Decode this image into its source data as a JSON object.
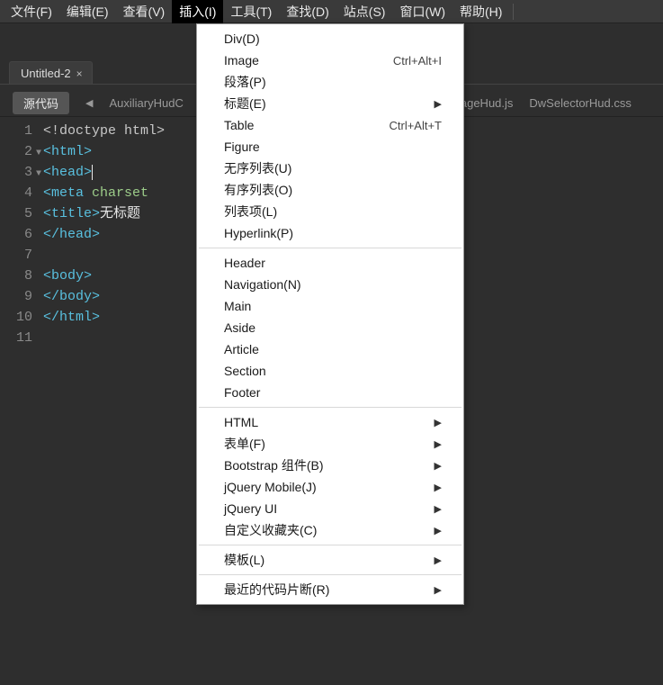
{
  "menubar": {
    "items": [
      {
        "label": "文件(F)"
      },
      {
        "label": "编辑(E)"
      },
      {
        "label": "查看(V)"
      },
      {
        "label": "插入(I)",
        "active": true
      },
      {
        "label": "工具(T)"
      },
      {
        "label": "查找(D)"
      },
      {
        "label": "站点(S)"
      },
      {
        "label": "窗口(W)"
      },
      {
        "label": "帮助(H)"
      }
    ]
  },
  "dropdown": {
    "groups": [
      [
        {
          "label": "Div(D)"
        },
        {
          "label": "Image",
          "shortcut": "Ctrl+Alt+I"
        },
        {
          "label": "段落(P)"
        },
        {
          "label": "标题(E)",
          "submenu": true
        },
        {
          "label": "Table",
          "shortcut": "Ctrl+Alt+T"
        },
        {
          "label": "Figure"
        },
        {
          "label": "无序列表(U)"
        },
        {
          "label": "有序列表(O)"
        },
        {
          "label": "列表项(L)"
        },
        {
          "label": "Hyperlink(P)"
        }
      ],
      [
        {
          "label": "Header"
        },
        {
          "label": "Navigation(N)"
        },
        {
          "label": "Main"
        },
        {
          "label": "Aside"
        },
        {
          "label": "Article"
        },
        {
          "label": "Section"
        },
        {
          "label": "Footer"
        }
      ],
      [
        {
          "label": "HTML",
          "submenu": true
        },
        {
          "label": "表单(F)",
          "submenu": true
        },
        {
          "label": "Bootstrap 组件(B)",
          "submenu": true
        },
        {
          "label": "jQuery Mobile(J)",
          "submenu": true
        },
        {
          "label": "jQuery UI",
          "submenu": true
        },
        {
          "label": "自定义收藏夹(C)",
          "submenu": true
        }
      ],
      [
        {
          "label": "模板(L)",
          "submenu": true
        }
      ],
      [
        {
          "label": "最近的代码片断(R)",
          "submenu": true
        }
      ]
    ]
  },
  "filetab": {
    "name": "Untitled-2",
    "close": "×"
  },
  "subtab": {
    "source": "源代码",
    "arrow_left": "◀",
    "files": [
      "AuxiliaryHudC",
      "ageHud.js",
      "DwSelectorHud.css"
    ]
  },
  "code": {
    "lines": [
      {
        "n": "1",
        "html": "<span class='tok-doctype'>&lt;!doctype html&gt;</span>"
      },
      {
        "n": "2",
        "fold": true,
        "html": "<span class='tok-angle'>&lt;</span><span class='tok-tag'>html</span><span class='tok-angle'>&gt;</span>"
      },
      {
        "n": "3",
        "fold": true,
        "html": "<span class='tok-angle'>&lt;</span><span class='tok-tag'>head</span><span class='tok-angle'>&gt;</span><span class='cursor-bar'></span>"
      },
      {
        "n": "4",
        "html": "<span class='tok-angle'>&lt;</span><span class='tok-tag'>meta </span><span class='tok-attr'>charset</span>"
      },
      {
        "n": "5",
        "html": "<span class='tok-angle'>&lt;</span><span class='tok-tag'>title</span><span class='tok-angle'>&gt;</span><span class='tok-text'>无标题</span>"
      },
      {
        "n": "6",
        "html": "<span class='tok-angle'>&lt;/</span><span class='tok-tag'>head</span><span class='tok-angle'>&gt;</span>"
      },
      {
        "n": "7",
        "html": ""
      },
      {
        "n": "8",
        "html": "<span class='tok-angle'>&lt;</span><span class='tok-tag'>body</span><span class='tok-angle'>&gt;</span>"
      },
      {
        "n": "9",
        "html": "<span class='tok-angle'>&lt;/</span><span class='tok-tag'>body</span><span class='tok-angle'>&gt;</span>"
      },
      {
        "n": "10",
        "html": "<span class='tok-angle'>&lt;/</span><span class='tok-tag'>html</span><span class='tok-angle'>&gt;</span>"
      },
      {
        "n": "11",
        "html": ""
      }
    ]
  }
}
